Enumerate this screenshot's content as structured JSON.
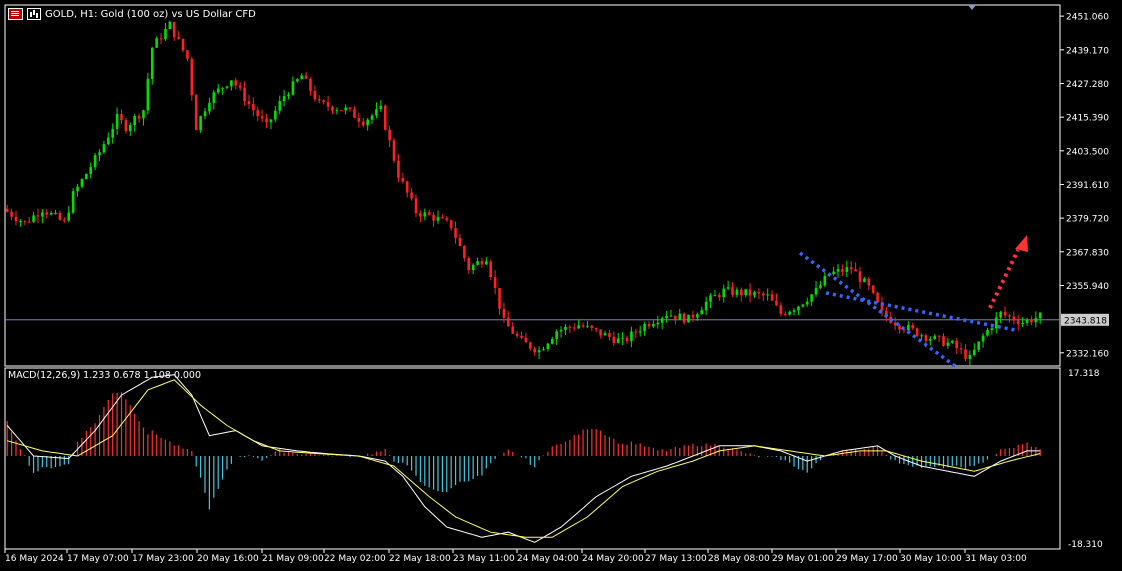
{
  "header": {
    "title": "GOLD, H1:  Gold (100 oz) vs US Dollar CFD",
    "icon_list": "list-icon",
    "icon_chart": "chart-icon"
  },
  "indicator": {
    "label": "MACD(12,26,9) 1.233 0.678 1.108 0.000"
  },
  "colors": {
    "background": "#000000",
    "bull": "#00e000",
    "bear": "#ff2020",
    "grid_line": "#8899cc",
    "trend_line": "#3366ff",
    "arrow": "#ff3333",
    "macd_main": "#ffffff",
    "macd_signal": "#ffff66",
    "hist_pos": "#ff3030",
    "hist_neg": "#40c8e0"
  },
  "chart_data": [
    {
      "type": "candlestick",
      "title": "GOLD, H1:  Gold (100 oz) vs US Dollar CFD",
      "y_ticks": [
        "2451.060",
        "2439.170",
        "2427.280",
        "2415.390",
        "2403.500",
        "2391.610",
        "2379.720",
        "2367.830",
        "2355.940",
        "2332.160"
      ],
      "ylim": [
        2327.5,
        2455.0
      ],
      "current_price": "2343.818",
      "x_ticks": [
        "16 May 2024",
        "17 May 07:00",
        "17 May 23:00",
        "20 May 16:00",
        "21 May 09:00",
        "22 May 02:00",
        "22 May 18:00",
        "23 May 11:00",
        "24 May 04:00",
        "24 May 20:00",
        "27 May 13:00",
        "28 May 08:00",
        "29 May 01:00",
        "29 May 17:00",
        "30 May 10:00",
        "31 May 03:00"
      ],
      "close_path": [
        [
          0,
          2383
        ],
        [
          5,
          2378
        ],
        [
          9,
          2383
        ],
        [
          14,
          2378
        ],
        [
          16,
          2388
        ],
        [
          22,
          2403
        ],
        [
          26,
          2415
        ],
        [
          28,
          2412
        ],
        [
          32,
          2418
        ],
        [
          34,
          2440
        ],
        [
          38,
          2448
        ],
        [
          42,
          2436
        ],
        [
          44,
          2412
        ],
        [
          47,
          2422
        ],
        [
          52,
          2429
        ],
        [
          56,
          2420
        ],
        [
          60,
          2412
        ],
        [
          64,
          2423
        ],
        [
          68,
          2430
        ],
        [
          72,
          2420
        ],
        [
          78,
          2418
        ],
        [
          82,
          2414
        ],
        [
          86,
          2418
        ],
        [
          90,
          2395
        ],
        [
          94,
          2382
        ],
        [
          98,
          2380
        ],
        [
          102,
          2377
        ],
        [
          106,
          2362
        ],
        [
          110,
          2366
        ],
        [
          114,
          2343
        ],
        [
          118,
          2336
        ],
        [
          122,
          2333
        ],
        [
          126,
          2340
        ],
        [
          131,
          2342
        ],
        [
          136,
          2339
        ],
        [
          141,
          2336
        ],
        [
          146,
          2342
        ],
        [
          151,
          2346
        ],
        [
          156,
          2344
        ],
        [
          160,
          2350
        ],
        [
          164,
          2354
        ],
        [
          170,
          2353
        ],
        [
          174,
          2352
        ],
        [
          177,
          2346
        ],
        [
          181,
          2349
        ],
        [
          185,
          2354
        ],
        [
          188,
          2360
        ],
        [
          193,
          2362
        ],
        [
          197,
          2355
        ],
        [
          200,
          2346
        ],
        [
          204,
          2342
        ],
        [
          210,
          2338
        ],
        [
          216,
          2335
        ],
        [
          220,
          2330
        ],
        [
          223,
          2338
        ],
        [
          227,
          2346
        ],
        [
          232,
          2343
        ],
        [
          236,
          2345
        ]
      ],
      "annotations": [
        "blue dotted descending trendline",
        "blue dotted converging trendline",
        "red dotted upward arrow"
      ]
    },
    {
      "type": "macd",
      "params": "MACD(12,26,9)",
      "values": {
        "main": "1.233",
        "signal": "0.678",
        "hist": "1.108",
        "other": "0.000"
      },
      "y_ticks": [
        "17.318",
        "-18.310"
      ],
      "ylim": [
        -18.31,
        17.318
      ],
      "main_path": [
        [
          0,
          6
        ],
        [
          6,
          0
        ],
        [
          14,
          -0.5
        ],
        [
          20,
          5
        ],
        [
          26,
          12
        ],
        [
          33,
          15.5
        ],
        [
          38,
          16
        ],
        [
          42,
          12
        ],
        [
          46,
          4
        ],
        [
          52,
          5
        ],
        [
          58,
          2
        ],
        [
          66,
          1
        ],
        [
          72,
          0.5
        ],
        [
          80,
          0
        ],
        [
          86,
          -1
        ],
        [
          90,
          -4
        ],
        [
          95,
          -10
        ],
        [
          100,
          -14
        ],
        [
          108,
          -16
        ],
        [
          114,
          -15
        ],
        [
          120,
          -17
        ],
        [
          126,
          -14
        ],
        [
          134,
          -8
        ],
        [
          142,
          -4
        ],
        [
          150,
          -2
        ],
        [
          156,
          0
        ],
        [
          162,
          2
        ],
        [
          170,
          2
        ],
        [
          176,
          1
        ],
        [
          182,
          -1
        ],
        [
          190,
          1
        ],
        [
          198,
          2
        ],
        [
          202,
          0
        ],
        [
          208,
          -2
        ],
        [
          214,
          -3
        ],
        [
          220,
          -4
        ],
        [
          226,
          -1
        ],
        [
          232,
          1
        ],
        [
          236,
          1
        ]
      ],
      "signal_path": [
        [
          0,
          3
        ],
        [
          8,
          1
        ],
        [
          16,
          0
        ],
        [
          24,
          4
        ],
        [
          32,
          13
        ],
        [
          38,
          15
        ],
        [
          44,
          10
        ],
        [
          50,
          6
        ],
        [
          56,
          3
        ],
        [
          62,
          1
        ],
        [
          70,
          0.5
        ],
        [
          80,
          0
        ],
        [
          88,
          -2
        ],
        [
          96,
          -8
        ],
        [
          102,
          -12
        ],
        [
          110,
          -15
        ],
        [
          118,
          -16
        ],
        [
          124,
          -16
        ],
        [
          132,
          -12
        ],
        [
          140,
          -6
        ],
        [
          148,
          -3
        ],
        [
          156,
          -1
        ],
        [
          162,
          1
        ],
        [
          170,
          2
        ],
        [
          178,
          1
        ],
        [
          186,
          0
        ],
        [
          194,
          1
        ],
        [
          200,
          1
        ],
        [
          208,
          -1
        ],
        [
          214,
          -2
        ],
        [
          220,
          -3
        ],
        [
          228,
          -1
        ],
        [
          236,
          0.7
        ]
      ]
    }
  ]
}
